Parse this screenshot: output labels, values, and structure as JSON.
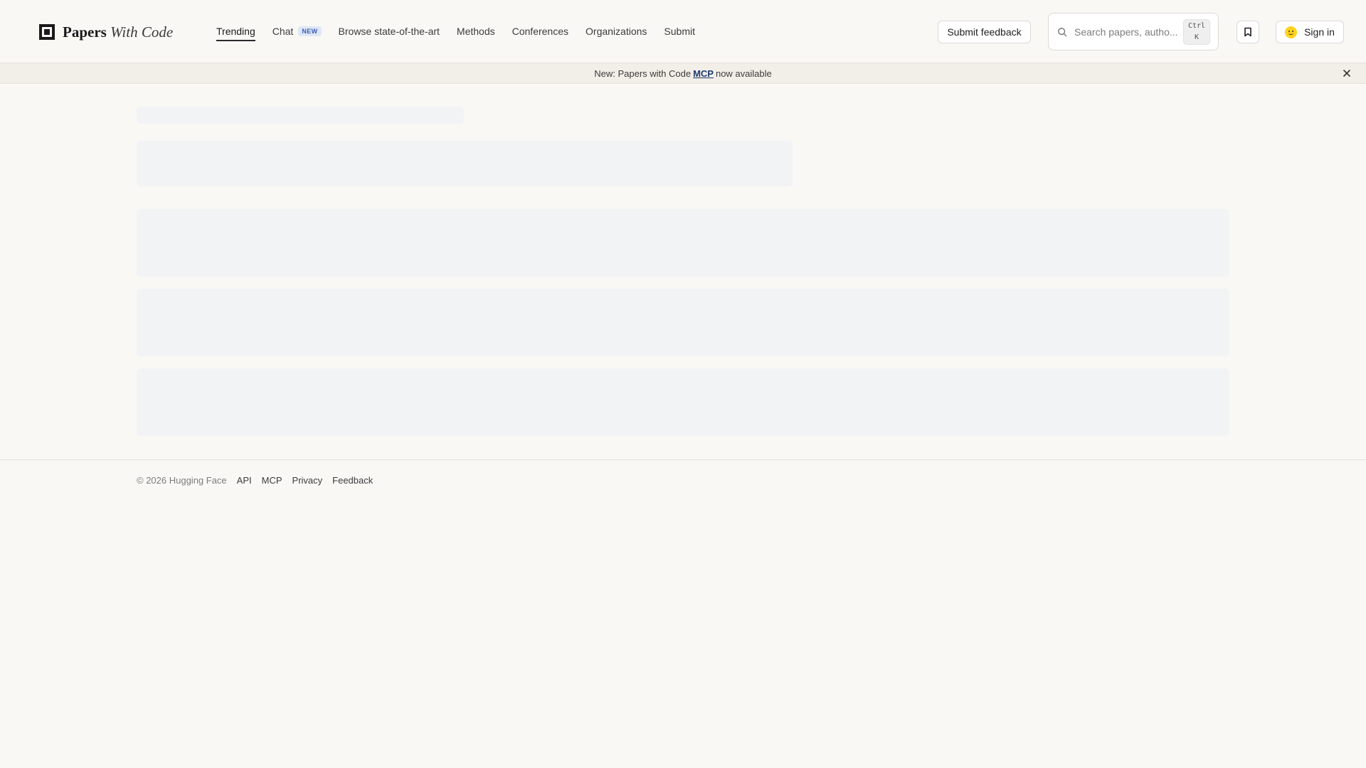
{
  "brand": {
    "name_primary": "Papers",
    "name_secondary": "With Code"
  },
  "nav": [
    {
      "label": "Trending",
      "active": true
    },
    {
      "label": "Chat",
      "badge": "NEW"
    },
    {
      "label": "Browse state-of-the-art"
    },
    {
      "label": "Methods"
    },
    {
      "label": "Conferences"
    },
    {
      "label": "Organizations"
    },
    {
      "label": "Submit"
    }
  ],
  "header": {
    "feedback_label": "Submit feedback",
    "search_placeholder": "Search papers, autho...",
    "search_shortcut_line1": "Ctrl",
    "search_shortcut_line2": "K",
    "signin_label": "Sign in"
  },
  "banner": {
    "prefix": "New: Papers with Code",
    "link": "MCP",
    "suffix": "now available"
  },
  "footer": {
    "copyright": "© 2026 Hugging Face",
    "links": [
      "API",
      "MCP",
      "Privacy",
      "Feedback"
    ]
  },
  "icons": {
    "search": "search-icon",
    "bookmark": "bookmark-icon",
    "close": "close-icon",
    "signin": "hugging-face-icon"
  },
  "colors": {
    "background": "#f9f8f5",
    "banner": "#f2efe8",
    "skeleton": "#f1f3f5",
    "badge_text": "#3d5fb0",
    "badge_bg": "#dfe7f7",
    "mcp_link": "#1d3a6e"
  }
}
